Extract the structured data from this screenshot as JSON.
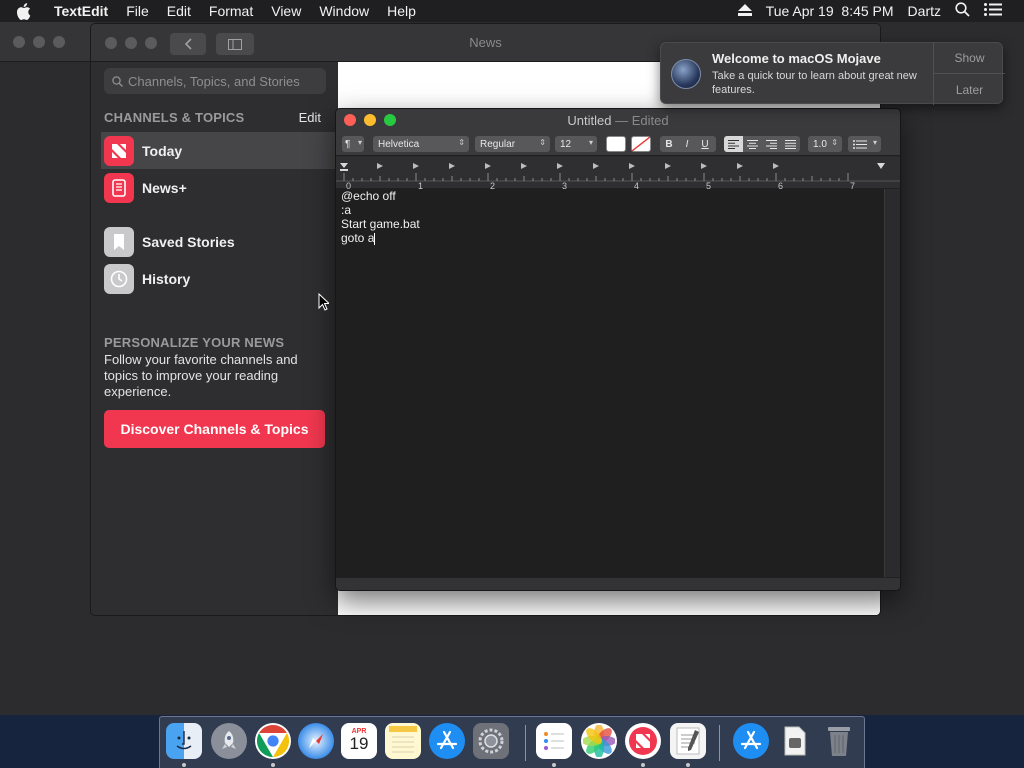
{
  "menubar": {
    "app_name": "TextEdit",
    "items": [
      "File",
      "Edit",
      "Format",
      "View",
      "Window",
      "Help"
    ],
    "datetime": "Tue Apr 19  8:45 PM",
    "user": "Dartz"
  },
  "news": {
    "window_title": "News",
    "search_placeholder": "Channels, Topics, and Stories",
    "section_channels": "CHANNELS & TOPICS",
    "edit_label": "Edit",
    "items": [
      {
        "label": "Today",
        "icon": "news-today-icon"
      },
      {
        "label": "News+",
        "icon": "news-plus-icon"
      },
      {
        "label": "Saved Stories",
        "icon": "bookmark-icon"
      },
      {
        "label": "History",
        "icon": "clock-icon"
      }
    ],
    "personalize_head": "PERSONALIZE YOUR NEWS",
    "personalize_body": "Follow your favorite channels and topics to improve your reading experience.",
    "discover_button": "Discover Channels & Topics",
    "accent": "#f0374f"
  },
  "textedit": {
    "title": "Untitled",
    "edited_suffix": "— Edited",
    "font_family": "Helvetica",
    "font_style": "Regular",
    "font_size": "12",
    "bold": "B",
    "italic": "I",
    "underline": "U",
    "line_spacing": "1.0",
    "ruler_numbers": [
      "0",
      "1",
      "2",
      "3",
      "4",
      "5",
      "6",
      "7"
    ],
    "lines": [
      "@echo off",
      ":a",
      "Start game.bat",
      "goto a"
    ]
  },
  "notification": {
    "title": "Welcome to macOS Mojave",
    "body": "Take a quick tour to learn about great new features.",
    "show": "Show",
    "later": "Later"
  },
  "dock": {
    "calendar_month": "APR",
    "calendar_day": "19"
  }
}
